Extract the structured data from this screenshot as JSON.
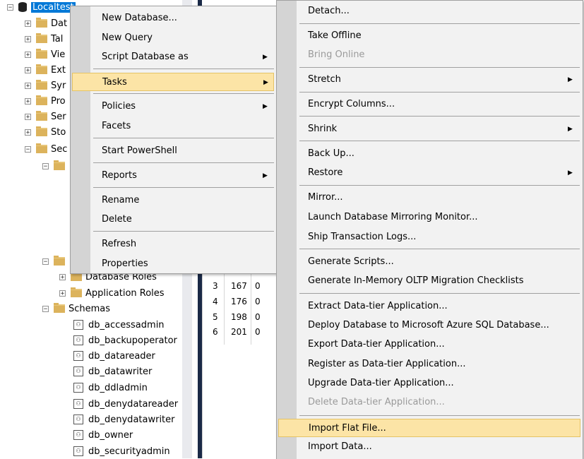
{
  "tree": {
    "root": "Localtest",
    "nodes": [
      "Dat",
      "Tal",
      "Vie",
      "Ext",
      "Syr",
      "Pro",
      "Ser",
      "Sto",
      "Sec"
    ],
    "database_roles": "Database Roles",
    "application_roles": "Application Roles",
    "schemas": "Schemas",
    "schema_items": [
      "db_accessadmin",
      "db_backupoperator",
      "db_datareader",
      "db_datawriter",
      "db_ddladmin",
      "db_denydatareader",
      "db_denydatawriter",
      "db_owner",
      "db_securityadmin"
    ],
    "expand_glyph": "+",
    "collapse_glyph": "−"
  },
  "grid": {
    "rows": [
      {
        "n": "3",
        "v": "167",
        "c": "0"
      },
      {
        "n": "4",
        "v": "176",
        "c": "0"
      },
      {
        "n": "5",
        "v": "198",
        "c": "0"
      },
      {
        "n": "6",
        "v": "201",
        "c": "0"
      }
    ]
  },
  "context_menu": {
    "new_database": "New Database...",
    "new_query": "New Query",
    "script_database_as": "Script Database as",
    "tasks": "Tasks",
    "policies": "Policies",
    "facets": "Facets",
    "start_powershell": "Start PowerShell",
    "reports": "Reports",
    "rename": "Rename",
    "delete": "Delete",
    "refresh": "Refresh",
    "properties": "Properties"
  },
  "tasks_menu": {
    "detach": "Detach...",
    "take_offline": "Take Offline",
    "bring_online": "Bring Online",
    "stretch": "Stretch",
    "encrypt_columns": "Encrypt Columns...",
    "shrink": "Shrink",
    "back_up": "Back Up...",
    "restore": "Restore",
    "mirror": "Mirror...",
    "launch_mirroring_monitor": "Launch Database Mirroring Monitor...",
    "ship_transaction_logs": "Ship Transaction Logs...",
    "generate_scripts": "Generate Scripts...",
    "generate_oltp_checklists": "Generate In-Memory OLTP Migration Checklists",
    "extract_dac": "Extract Data-tier Application...",
    "deploy_azure": "Deploy Database to Microsoft Azure SQL Database...",
    "export_dac": "Export Data-tier Application...",
    "register_dac": "Register as Data-tier Application...",
    "upgrade_dac": "Upgrade Data-tier Application...",
    "delete_dac": "Delete Data-tier Application...",
    "import_flat_file": "Import Flat File...",
    "import_data": "Import Data..."
  },
  "submenu_arrow": "▶",
  "colors": {
    "highlight": "#fce4a6",
    "selection": "#0078d7",
    "menu_bg": "#f2f2f2",
    "gutter": "#d4d4d4",
    "folder": "#dcb35c"
  }
}
